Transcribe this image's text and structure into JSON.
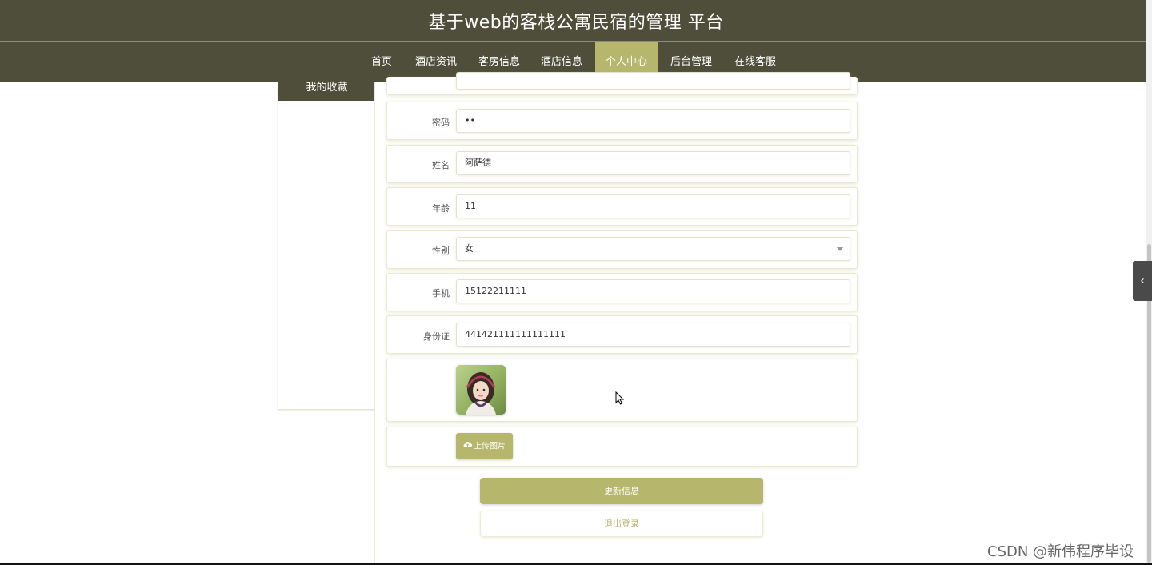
{
  "header": {
    "title": "基于web的客栈公寓民宿的管理 平台"
  },
  "nav": {
    "items": [
      {
        "label": "首页"
      },
      {
        "label": "酒店资讯"
      },
      {
        "label": "客房信息"
      },
      {
        "label": "酒店信息"
      },
      {
        "label": "个人中心"
      },
      {
        "label": "后台管理"
      },
      {
        "label": "在线客服"
      }
    ],
    "active": "个人中心",
    "active_color": "#b6b66d",
    "bar_color": "#4f4e3a"
  },
  "sidebar": {
    "tab_label": "我的收藏"
  },
  "form": {
    "password": {
      "label": "密码",
      "value": "••"
    },
    "name": {
      "label": "姓名",
      "value": "阿萨德"
    },
    "age": {
      "label": "年龄",
      "value": "11"
    },
    "gender": {
      "label": "性别",
      "value": "女"
    },
    "phone": {
      "label": "手机",
      "value": "15122211111"
    },
    "id_card": {
      "label": "身份证",
      "value": "441421111111111111"
    },
    "avatar_icon": "profile-photo",
    "upload_label": "上传图片"
  },
  "actions": {
    "update_label": "更新信息",
    "logout_label": "退出登录"
  },
  "side_toggle": {
    "icon": "chevron-left-icon",
    "glyph": "‹"
  },
  "watermark": "CSDN @新伟程序毕设"
}
